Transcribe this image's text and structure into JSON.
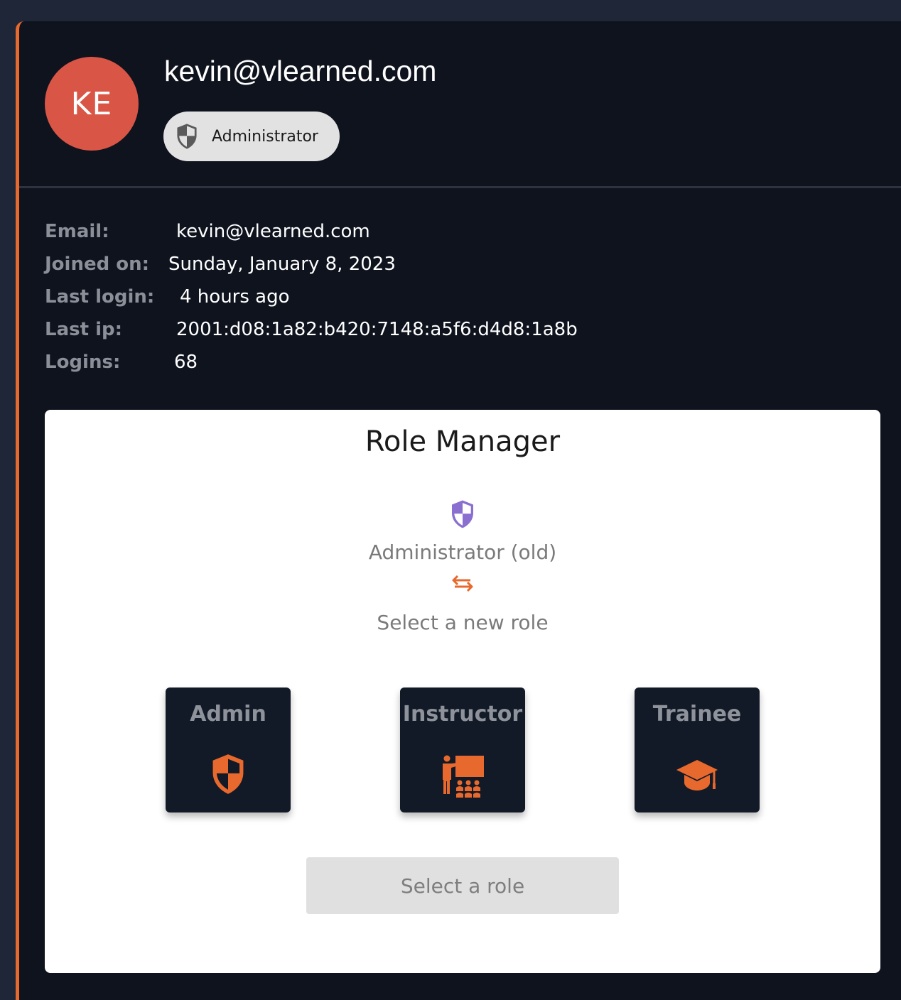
{
  "user": {
    "initials": "KE",
    "title_email": "kevin@vlearned.com",
    "role_badge": "Administrator"
  },
  "details": [
    {
      "label": "Email:",
      "value": "kevin@vlearned.com"
    },
    {
      "label": "Joined on:",
      "value": "Sunday, January 8, 2023"
    },
    {
      "label": "Last login:",
      "value": "4 hours ago"
    },
    {
      "label": "Last ip:",
      "value": "2001:d08:1a82:b420:7148:a5f6:d4d8:1a8b"
    },
    {
      "label": "Logins:",
      "value": "68"
    }
  ],
  "role_manager": {
    "title": "Role Manager",
    "current_role": "Administrator (old)",
    "prompt": "Select a new role",
    "roles": [
      {
        "label": "Admin",
        "icon": "shield-icon"
      },
      {
        "label": "Instructor",
        "icon": "instructor-icon"
      },
      {
        "label": "Trainee",
        "icon": "graduation-cap-icon"
      }
    ],
    "submit_label": "Select a role"
  },
  "colors": {
    "accent": "#e8692e",
    "avatar": "#d95546",
    "current_role_icon": "#8a6fd0",
    "panel": "#0e131e",
    "tile": "#131a27"
  }
}
